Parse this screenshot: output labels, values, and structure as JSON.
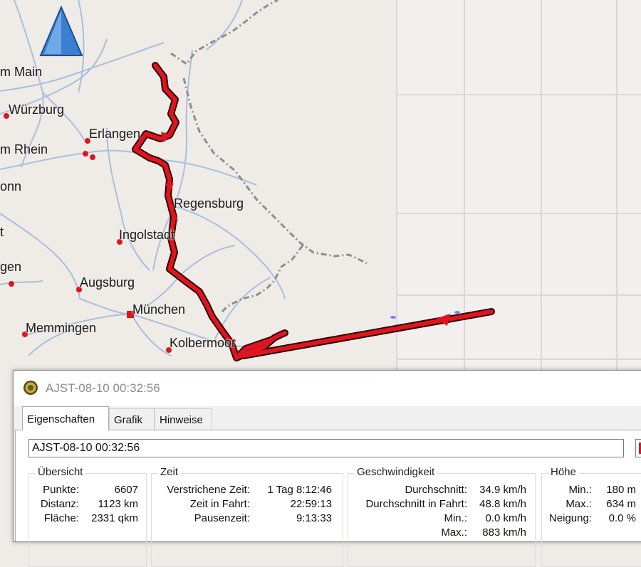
{
  "map": {
    "cities": [
      {
        "name": "m Main"
      },
      {
        "name": "Würzburg"
      },
      {
        "name": "Erlangen"
      },
      {
        "name": "m Rhein"
      },
      {
        "name": "onn"
      },
      {
        "name": "Regensburg"
      },
      {
        "name": "t"
      },
      {
        "name": "Ingolstadt"
      },
      {
        "name": "gen"
      },
      {
        "name": "Augsburg"
      },
      {
        "name": "München"
      },
      {
        "name": "Memmingen"
      },
      {
        "name": "Kolbermoor"
      }
    ],
    "colors": {
      "track": "#e0141e",
      "track_outline": "#2a0000",
      "roads": "#a9bfdc",
      "border": "#8e8e8e",
      "background": "#efebe6",
      "compass": "#3a7fd0"
    }
  },
  "dialog": {
    "title": "AJST-08-10 00:32:56",
    "tabs": [
      "Eigenschaften",
      "Grafik",
      "Hinweise"
    ],
    "name_value": "AJST-08-10 00:32:56",
    "groups": {
      "uebersicht": {
        "title": "Übersicht",
        "rows": [
          {
            "label": "Punkte:",
            "value": "6607"
          },
          {
            "label": "Distanz:",
            "value": "1123 km"
          },
          {
            "label": "Fläche:",
            "value": "2331 qkm"
          }
        ]
      },
      "zeit": {
        "title": "Zeit",
        "rows": [
          {
            "label": "Verstrichene Zeit:",
            "value": "1 Tag 8:12:46"
          },
          {
            "label": "Zeit in Fahrt:",
            "value": "22:59:13"
          },
          {
            "label": "Pausenzeit:",
            "value": "9:13:33"
          }
        ]
      },
      "geschwindigkeit": {
        "title": "Geschwindigkeit",
        "rows": [
          {
            "label": "Durchschnitt:",
            "value": "34.9 km/h"
          },
          {
            "label": "Durchschnitt in Fahrt:",
            "value": "48.8 km/h"
          },
          {
            "label": "Min.:",
            "value": "0.0 km/h"
          },
          {
            "label": "Max.:",
            "value": "883 km/h"
          }
        ]
      },
      "hoehe": {
        "title": "Höhe",
        "rows": [
          {
            "label": "Min.:",
            "value": "180 m"
          },
          {
            "label": "Max.:",
            "value": "634 m"
          },
          {
            "label": "Neigung:",
            "value": "0.0 %"
          }
        ]
      }
    }
  }
}
